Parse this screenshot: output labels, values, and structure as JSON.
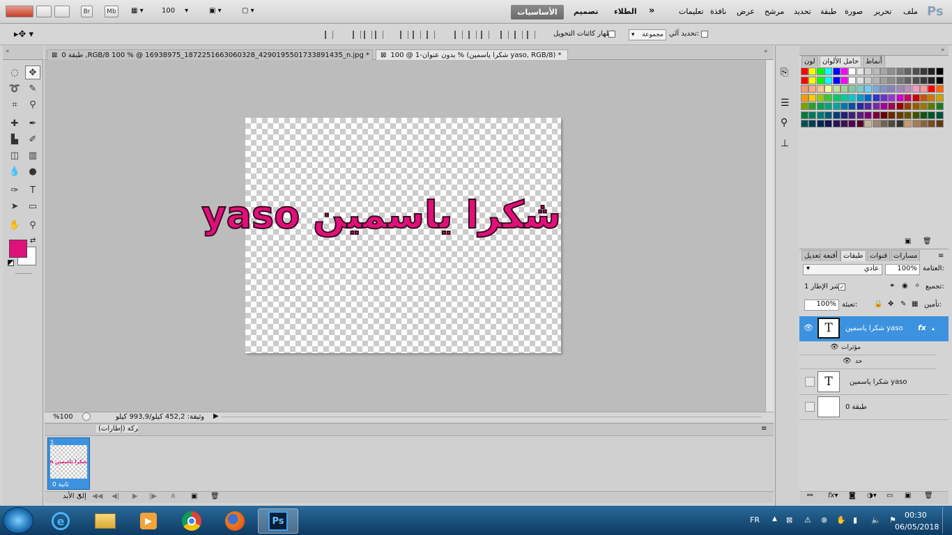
{
  "menubar": {
    "menus": [
      "ملف",
      "تحرير",
      "صورة",
      "طبقة",
      "تحديد",
      "مرشح",
      "عرض",
      "نافذة",
      "تعليمات"
    ],
    "app_logo": "Ps",
    "workspaces": [
      "الأساسيات",
      "تصميم",
      "الطلاء"
    ],
    "more_workspaces_glyph": "»",
    "bridge_label": "Br",
    "mini_bridge_label": "Mb",
    "zoom_value": "100"
  },
  "options": {
    "auto_select_label": "تحديد آلي:",
    "auto_select_value": "مجموعة",
    "show_transform_label": "إظهار كائنات التحويل"
  },
  "tabs": [
    {
      "label": "طبقة 0 ,RGB/8 100 % @ 16938975_1872251663060328_4290195501733891435_n.jpg *"
    },
    {
      "label": "بدون عنوان-1 @ 100 % (شكرا ياسمين yaso, RGB/8) *"
    }
  ],
  "artboard": {
    "text": "شكرا ياسمين yaso",
    "text_color": "#e0107a"
  },
  "status": {
    "zoom": "%100",
    "doc_info": "وثيقة: 452,2 كيلو/993,9 كيلو"
  },
  "animation": {
    "title": "حركة (إطارات)",
    "frame_number": "1",
    "frame_thumb_text": "شكرا ياسمين yaso",
    "frame_delay": "0 ثانية",
    "loop": "إلى الأبد"
  },
  "swatches_panel": {
    "tabs": [
      "لون",
      "حامل الألوان",
      "أنماط"
    ],
    "colors": [
      "#ff0000",
      "#ffff00",
      "#00ff00",
      "#00ffff",
      "#0000ff",
      "#ff00ff",
      "#ffffff",
      "#e6e6e6",
      "#d0d0d0",
      "#bbbbbb",
      "#a6a6a6",
      "#909090",
      "#7a7a7a",
      "#646464",
      "#4e4e4e",
      "#383838",
      "#222222",
      "#000000",
      "#ff0000",
      "#ffff00",
      "#00ff00",
      "#00ffff",
      "#0000ff",
      "#ff00ff",
      "#f5f5f5",
      "#e0e0e0",
      "#cbcbcb",
      "#b6b6b6",
      "#a1a1a1",
      "#8c8c8c",
      "#777777",
      "#626262",
      "#4d4d4d",
      "#383838",
      "#232323",
      "#000000",
      "#f7977a",
      "#f9ad81",
      "#fdc68a",
      "#fff79a",
      "#c4df9b",
      "#a3d39c",
      "#82ca9d",
      "#7bcdc8",
      "#6ecff6",
      "#7ea7d8",
      "#8493ca",
      "#8882be",
      "#a187be",
      "#bc8dbf",
      "#f49ac2",
      "#f6989d",
      "#ff0000",
      "#ff6600",
      "#ff9900",
      "#ffcc00",
      "#99cc00",
      "#33cc33",
      "#00cc66",
      "#00cc99",
      "#00cccc",
      "#0099cc",
      "#0066cc",
      "#3333cc",
      "#6633cc",
      "#9933cc",
      "#cc00cc",
      "#cc0066",
      "#cc0000",
      "#cc5200",
      "#cc7a00",
      "#cca300",
      "#7aa300",
      "#29a329",
      "#00a352",
      "#00a37a",
      "#00a3a3",
      "#007aa3",
      "#0052a3",
      "#2929a3",
      "#5229a3",
      "#7a29a3",
      "#a300a3",
      "#a30052",
      "#990000",
      "#993d00",
      "#995c00",
      "#997a00",
      "#5c7a00",
      "#1f7a1f",
      "#007a3d",
      "#007a5c",
      "#007a7a",
      "#005c7a",
      "#003d7a",
      "#1f1f7a",
      "#3d1f7a",
      "#5c1f7a",
      "#7a007a",
      "#7a003d",
      "#660000",
      "#662900",
      "#663d00",
      "#665200",
      "#3d5200",
      "#145214",
      "#005229",
      "#00523d",
      "#005252",
      "#003d52",
      "#002952",
      "#141452",
      "#291452",
      "#3d1452",
      "#520052",
      "#520029",
      "#c7b299",
      "#998675",
      "#736357",
      "#534741",
      "#37302d",
      "#c69c6d",
      "#a67c52",
      "#8c6239",
      "#754c24",
      "#603913"
    ]
  },
  "layers_panel": {
    "tabs": [
      "طبقات",
      "قنوات",
      "مسارات",
      "أقنعة",
      "تعديل"
    ],
    "blend_mode": "عادي",
    "opacity_label": "العتامة:",
    "opacity": "100%",
    "unify_label": "تجميع:",
    "propagate_label": "نشر الإطار 1",
    "lock_label": "تأمين:",
    "fill_label": "تعبئة:",
    "fill": "100%",
    "layers": [
      {
        "name": "شكرا ياسمين yaso",
        "selected": true,
        "fx": "fx",
        "effects_label": "مؤثرات",
        "effect": "حد"
      },
      {
        "name": "شكرا ياسمين yaso",
        "selected": false
      },
      {
        "name": "طبقة 0",
        "selected": false
      }
    ]
  },
  "taskbar": {
    "lang": "FR",
    "time": "00:30",
    "date": "06/05/2018"
  }
}
